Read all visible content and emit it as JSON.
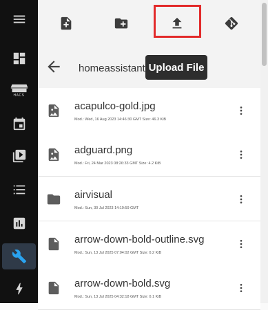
{
  "sidebar": {
    "items": [
      {
        "name": "menu-icon"
      },
      {
        "name": "dashboard-icon"
      },
      {
        "name": "hacs-icon",
        "label": "HACS"
      },
      {
        "name": "calendar-icon"
      },
      {
        "name": "media-icon"
      },
      {
        "name": "todo-list-icon"
      },
      {
        "name": "history-icon"
      },
      {
        "name": "wrench-icon",
        "active": true
      },
      {
        "name": "energy-icon"
      }
    ],
    "active_color": "#2aa3ef"
  },
  "toolbar": {
    "buttons": [
      "new-file-icon",
      "new-folder-icon",
      "upload-icon",
      "git-icon"
    ]
  },
  "path": {
    "text": "homeassistant/",
    "tooltip": "Upload File"
  },
  "files": [
    {
      "name": "acapulco-gold.jpg",
      "meta": "Mod.: Wed, 16 Aug 2023 14:46:30 GMT  Size: 46.3 KiB",
      "type": "image"
    },
    {
      "name": "adguard.png",
      "meta": "Mod.: Fri, 24 Mar 2023 08:26:33 GMT  Size: 4.2 KiB",
      "type": "image"
    },
    {
      "name": "airvisual",
      "meta": "Mod.: Sun, 30 Jul 2023 14:19:59 GMT",
      "type": "folder"
    },
    {
      "name": "arrow-down-bold-outline.svg",
      "meta": "Mod.: Sun, 13 Jul 2025 07:04:02 GMT  Size: 0.2 KiB",
      "type": "file"
    },
    {
      "name": "arrow-down-bold.svg",
      "meta": "Mod.: Sun, 13 Jul 2025 04:32:18 GMT  Size: 0.1 KiB",
      "type": "file"
    }
  ],
  "highlight_color": "#e22a2a"
}
